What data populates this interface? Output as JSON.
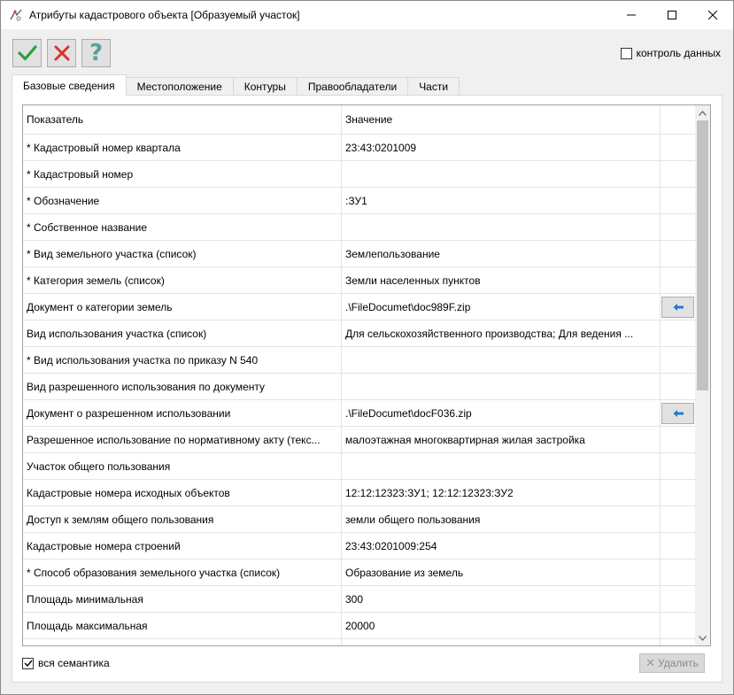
{
  "window": {
    "title": "Атрибуты кадастрового объекта [Образуемый участок]"
  },
  "toolbar": {
    "ok_icon": "check-icon",
    "cancel_icon": "cross-icon",
    "help_glyph": "?"
  },
  "data_control": {
    "label": "контроль данных",
    "checked": false
  },
  "tabs": [
    {
      "label": "Базовые сведения",
      "active": true
    },
    {
      "label": "Местоположение"
    },
    {
      "label": "Контуры"
    },
    {
      "label": "Правообладатели"
    },
    {
      "label": "Части"
    }
  ],
  "grid": {
    "columns": [
      "Показатель",
      "Значение"
    ],
    "rows": [
      {
        "name": "* Кадастровый номер квартала",
        "value": "23:43:0201009"
      },
      {
        "name": "* Кадастровый номер",
        "value": ""
      },
      {
        "name": "* Обозначение",
        "value": ":ЗУ1"
      },
      {
        "name": "* Собственное название",
        "value": ""
      },
      {
        "name": "* Вид земельного участка (список)",
        "value": "Землепользование"
      },
      {
        "name": "* Категория земель (список)",
        "value": "Земли населенных пунктов"
      },
      {
        "name": "Документ о категории земель",
        "value": ".\\FileDocumet\\doc989F.zip",
        "button": "arrow-left-icon"
      },
      {
        "name": "Вид использования участка (список)",
        "value": "Для сельскохозяйственного производства; Для ведения ..."
      },
      {
        "name": "* Вид использования участка по приказу N 540",
        "value": ""
      },
      {
        "name": "Вид разрешенного использования по документу",
        "value": ""
      },
      {
        "name": "Документ о разрешенном использовании",
        "value": ".\\FileDocumet\\docF036.zip",
        "button": "arrow-left-icon"
      },
      {
        "name": "Разрешенное использование по нормативному акту (текс...",
        "value": "малоэтажная многоквартирная жилая застройка"
      },
      {
        "name": "Участок общего пользования",
        "value": ""
      },
      {
        "name": "Кадастровые номера исходных объектов",
        "value": "12:12:12323:ЗУ1; 12:12:12323:ЗУ2"
      },
      {
        "name": "Доступ к землям общего пользования",
        "value": "земли общего пользования"
      },
      {
        "name": "Кадастровые номера строений",
        "value": "23:43:0201009:254"
      },
      {
        "name": "* Способ образования земельного участка (список)",
        "value": "Образование из земель"
      },
      {
        "name": "Площадь минимальная",
        "value": "300"
      },
      {
        "name": "Площадь максимальная",
        "value": "20000"
      },
      {
        "name": "",
        "value": ""
      }
    ]
  },
  "footer": {
    "all_semantics_label": "вся семантика",
    "all_semantics_checked": true,
    "delete_label": "Удалить"
  },
  "colors": {
    "ok": "#2e9e3e",
    "cancel": "#d9342b",
    "help": "#5aa0a0",
    "row_button_arrow": "#1e78d2"
  }
}
